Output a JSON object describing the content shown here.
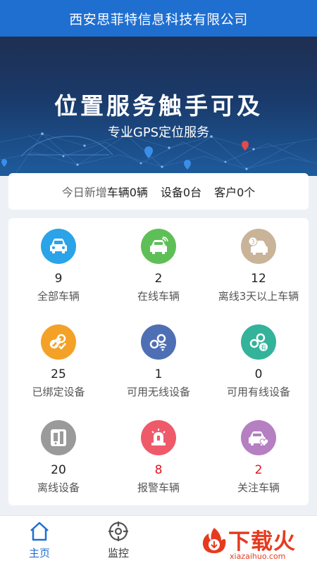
{
  "header": {
    "title": "西安思菲特信息科技有限公司"
  },
  "banner": {
    "title": "位置服务触手可及",
    "subtitle": "专业GPS定位服务"
  },
  "today": {
    "label": "今日新增",
    "vehicles": "车辆0辆",
    "devices": "设备0台",
    "customers": "客户0个"
  },
  "stats": [
    {
      "value": "9",
      "label": "全部车辆",
      "icon": "car-icon",
      "color": "#2aa3e8"
    },
    {
      "value": "2",
      "label": "在线车辆",
      "icon": "online-car-icon",
      "color": "#5fbf57"
    },
    {
      "value": "12",
      "label": "离线3天以上车辆",
      "icon": "offline-car-icon",
      "color": "#c9b49a"
    },
    {
      "value": "25",
      "label": "已绑定设备",
      "icon": "bound-device-icon",
      "color": "#f3a227"
    },
    {
      "value": "1",
      "label": "可用无线设备",
      "icon": "wireless-device-icon",
      "color": "#4f6fb5"
    },
    {
      "value": "0",
      "label": "可用有线设备",
      "icon": "wired-device-icon",
      "color": "#33b39a"
    },
    {
      "value": "20",
      "label": "离线设备",
      "icon": "offline-device-icon",
      "color": "#9a9a9a"
    },
    {
      "value": "8",
      "label": "报警车辆",
      "icon": "alarm-icon",
      "color": "#ef5a6a"
    },
    {
      "value": "2",
      "label": "关注车辆",
      "icon": "favorite-car-icon",
      "color": "#b57fc1"
    }
  ],
  "tabs": [
    {
      "label": "主页",
      "icon": "home-icon"
    },
    {
      "label": "监控",
      "icon": "monitor-icon"
    }
  ],
  "watermark": {
    "text": "下载火",
    "url": "xiazaihuo.com"
  }
}
